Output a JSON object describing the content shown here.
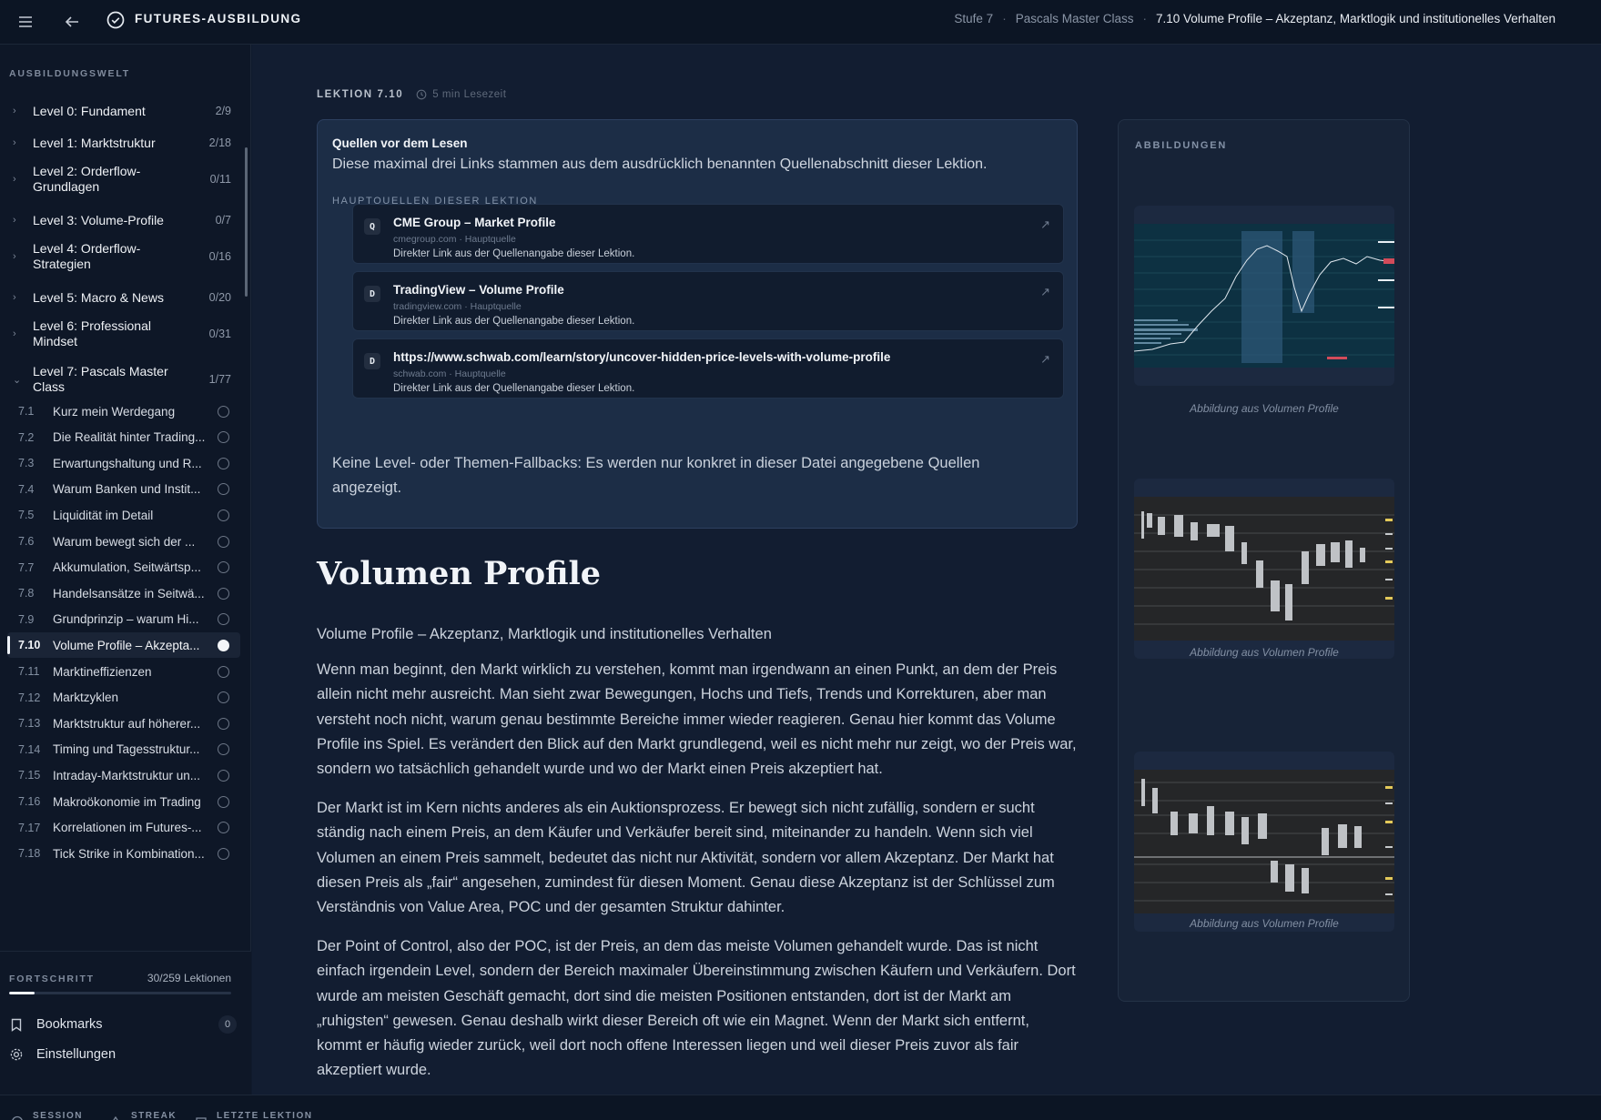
{
  "topbar": {
    "brand": "FUTURES-AUSBILDUNG",
    "breadcrumb": [
      "Stufe 7",
      "Pascals Master Class",
      "7.10 Volume Profile – Akzeptanz, Marktlogik und institutionelles Verhalten"
    ]
  },
  "sidebar": {
    "header": "AUSBILDUNGSWELT",
    "levels": [
      {
        "label": "Level 0: Fundament",
        "count": "2/9",
        "chev": "›"
      },
      {
        "label": "Level 1: Marktstruktur",
        "count": "2/18",
        "chev": "›"
      },
      {
        "label": "Level 2: Orderflow-Grundlagen",
        "count": "0/11",
        "chev": "›"
      },
      {
        "label": "Level 3: Volume-Profile",
        "count": "0/7",
        "chev": "›"
      },
      {
        "label": "Level 4: Orderflow-Strategien",
        "count": "0/16",
        "chev": "›"
      },
      {
        "label": "Level 5: Macro & News",
        "count": "0/20",
        "chev": "›"
      },
      {
        "label": "Level 6: Professional Mindset",
        "count": "0/31",
        "chev": "›"
      },
      {
        "label": "Level 7: Pascals Master Class",
        "count": "1/77",
        "chev": "⌄"
      }
    ],
    "lessons": [
      {
        "num": "7.1",
        "title": "Kurz mein Werdegang"
      },
      {
        "num": "7.2",
        "title": "Die Realität hinter Trading..."
      },
      {
        "num": "7.3",
        "title": "Erwartungshaltung und R..."
      },
      {
        "num": "7.4",
        "title": "Warum Banken und Instit..."
      },
      {
        "num": "7.5",
        "title": "Liquidität im Detail"
      },
      {
        "num": "7.6",
        "title": "Warum bewegt sich der ..."
      },
      {
        "num": "7.7",
        "title": "Akkumulation, Seitwärtsp..."
      },
      {
        "num": "7.8",
        "title": "Handelsansätze in Seitwä..."
      },
      {
        "num": "7.9",
        "title": "Grundprinzip – warum Hi..."
      },
      {
        "num": "7.10",
        "title": "Volume Profile – Akzepta..."
      },
      {
        "num": "7.11",
        "title": "Marktineffizienzen"
      },
      {
        "num": "7.12",
        "title": "Marktzyklen"
      },
      {
        "num": "7.13",
        "title": "Marktstruktur auf höherer..."
      },
      {
        "num": "7.14",
        "title": "Timing und Tagesstruktur..."
      },
      {
        "num": "7.15",
        "title": "Intraday-Marktstruktur un..."
      },
      {
        "num": "7.16",
        "title": "Makroökonomie im Trading"
      },
      {
        "num": "7.17",
        "title": "Korrelationen im Futures-..."
      },
      {
        "num": "7.18",
        "title": "Tick Strike in Kombination..."
      }
    ],
    "progress": {
      "label": "FORTSCHRITT",
      "count": "30/259 Lektionen",
      "fraction": 0.116
    },
    "bookmarks": {
      "label": "Bookmarks",
      "count": "0"
    },
    "settings": {
      "label": "Einstellungen"
    }
  },
  "statusbar": {
    "session": "SESSION",
    "streak": "STREAK",
    "last": "LETZTE LEKTION"
  },
  "lesson": {
    "tag": "LEKTION 7.10",
    "read_time": "5 min Lesezeit",
    "sources": {
      "title": "Quellen vor dem Lesen",
      "subtitle": "Diese maximal drei Links stammen aus dem ausdrücklich benannten Quellenabschnitt dieser Lektion.",
      "label": "HAUPTQUELLEN DIESER LEKTION",
      "items": [
        {
          "letter": "Q",
          "name": "CME Group – Market Profile",
          "domain": "cmegroup.com · Hauptquelle",
          "desc": "Direkter Link aus der Quellenangabe dieser Lektion."
        },
        {
          "letter": "D",
          "name": "TradingView – Volume Profile",
          "domain": "tradingview.com · Hauptquelle",
          "desc": "Direkter Link aus der Quellenangabe dieser Lektion."
        },
        {
          "letter": "D",
          "name": "https://www.schwab.com/learn/story/uncover-hidden-price-levels-with-volume-profile",
          "domain": "schwab.com · Hauptquelle",
          "desc": "Direkter Link aus der Quellenangabe dieser Lektion."
        }
      ],
      "note": "Keine Level- oder Themen-Fallbacks: Es werden nur konkret in dieser Datei angegebene Quellen angezeigt."
    },
    "heading": "Volumen Profile",
    "paragraphs": [
      "Volume Profile – Akzeptanz, Marktlogik und institutionelles Verhalten",
      "Wenn man beginnt, den Markt wirklich zu verstehen, kommt man irgendwann an einen Punkt, an dem der Preis allein nicht mehr ausreicht. Man sieht zwar Bewegungen, Hochs und Tiefs, Trends und Korrekturen, aber man versteht noch nicht, warum genau bestimmte Bereiche immer wieder reagieren. Genau hier kommt das Volume Profile ins Spiel. Es verändert den Blick auf den Markt grundlegend, weil es nicht mehr nur zeigt, wo der Preis war, sondern wo tatsächlich gehandelt wurde und wo der Markt einen Preis akzeptiert hat.",
      "Der Markt ist im Kern nichts anderes als ein Auktionsprozess. Er bewegt sich nicht zufällig, sondern er sucht ständig nach einem Preis, an dem Käufer und Verkäufer bereit sind, miteinander zu handeln. Wenn sich viel Volumen an einem Preis sammelt, bedeutet das nicht nur Aktivität, sondern vor allem Akzeptanz. Der Markt hat diesen Preis als „fair“ angesehen, zumindest für diesen Moment. Genau diese Akzeptanz ist der Schlüssel zum Verständnis von Value Area, POC und der gesamten Struktur dahinter.",
      "Der Point of Control, also der POC, ist der Preis, an dem das meiste Volumen gehandelt wurde. Das ist nicht einfach irgendein Level, sondern der Bereich maximaler Übereinstimmung zwischen Käufern und Verkäufern. Dort wurde am meisten Geschäft gemacht, dort sind die meisten Positionen entstanden, dort ist der Markt am „ruhigsten“ gewesen. Genau deshalb wirkt dieser Bereich oft wie ein Magnet. Wenn der Markt sich entfernt, kommt er häufig wieder zurück, weil dort noch offene Interessen liegen und weil dieser Preis zuvor als fair akzeptiert wurde."
    ]
  },
  "figures": {
    "title": "ABBILDUNGEN",
    "captions": [
      "Abbildung aus Volumen Profile",
      "Abbildung aus Volumen Profile",
      "Abbildung aus Volumen Profile"
    ]
  }
}
